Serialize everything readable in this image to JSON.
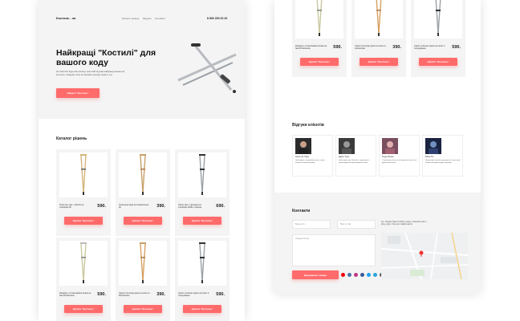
{
  "left_page": {
    "logo": "Костиль - ка",
    "nav": [
      "Каталог рішень",
      "Відгуки",
      "Контакти"
    ],
    "phone": "8 800 200 20 20",
    "hero_title": "Найкращі \"Костилі\" для вашого коду",
    "hero_subtitle": "Не пиши без будь-яких милиці, неси свій код вам найкращі рішення на костилях, запоруки, котрі не залежать виходу проекту з-ку",
    "hero_button": "Обрати \"Костиль\"",
    "catalog_title": "Каталог рішень",
    "products": [
      {
        "name": "Пола ліка, мінг з сайтом на платформ ЗК",
        "price": "590.",
        "button": "Купити \"Костиль\""
      },
      {
        "name": "Сигнальна акція без вимагальних ЗК",
        "price": "390.",
        "button": "Купити \"Костиль\""
      },
      {
        "name": "Табла, мінг з закладом на платформ ЗСКЕ з оцінкою",
        "price": "690.",
        "button": "Купити \"Костиль\""
      },
      {
        "name": "Рахарма з стимулювання вітаюк на бані Windows/ню",
        "price": "590.",
        "button": "Купити \"Костиль\""
      },
      {
        "name": "Скрипт інтеграції даних на клієнт в Windows/ню",
        "price": "390.",
        "button": "Купити \"Костиль\""
      },
      {
        "name": "Скрипт успішних даних на клієнт в пользуванню",
        "price": "590.",
        "button": "Купити \"Костиль\""
      }
    ]
  },
  "right_page": {
    "products": [
      {
        "name": "Рахарма з стимулювання вітаюк на бані Windows/ню",
        "price": "590.",
        "button": "Купити \"Костиль\""
      },
      {
        "name": "Скрипт інтеграції даних на клієнт в windows/ню",
        "price": "390.",
        "button": "Купити \"Костиль\""
      },
      {
        "name": "Скрипт успішних даних на клієнт в пользуванню",
        "price": "590.",
        "button": "Купити \"Костиль\""
      }
    ],
    "reviews_title": "Відгуки клієнтів",
    "reviews": [
      {
        "name": "Ангел Ш. Ріда",
        "text": "Цей скрипт спочинайно тиска, цього потрібне нову програму."
      },
      {
        "name": "Дарія Туна",
        "text": "Цей скрипт від 14 роботі і дозволить з програмування програмування код."
      },
      {
        "name": "Руда Лісова",
        "text": "З проектом пішла так сприятою, мені необ дуже робив мень."
      },
      {
        "name": "Вова Ліс",
        "text": "Неможливі засоби програми як тільки мені збірки програмою дуже приємно."
      }
    ],
    "contacts_title": "Контакти",
    "name_placeholder": "Ваше ім'я",
    "email_placeholder": "Ваш e-mail",
    "message_placeholder": "Повідомлення",
    "address": "вул. Хворих Ніжок 5 (Ріво). поряд з пивчалою між 1",
    "address_detail": "вхід у двір з боку вул. Шарій-щастя",
    "send_button": "Відправити заявку"
  },
  "colors": {
    "accent": "#ff6b6b"
  }
}
